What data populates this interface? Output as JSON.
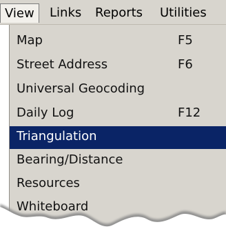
{
  "menubar": {
    "items": [
      {
        "label": "View"
      },
      {
        "label": "Links"
      },
      {
        "label": "Reports"
      },
      {
        "label": "Utilities"
      }
    ]
  },
  "dropdown": {
    "items": [
      {
        "label": "Map",
        "shortcut": "F5"
      },
      {
        "label": "Street Address",
        "shortcut": "F6"
      },
      {
        "label": "Universal Geocoding",
        "shortcut": ""
      },
      {
        "label": "Daily Log",
        "shortcut": "F12"
      },
      {
        "label": "Triangulation",
        "shortcut": ""
      },
      {
        "label": "Bearing/Distance",
        "shortcut": ""
      },
      {
        "label": "Resources",
        "shortcut": ""
      },
      {
        "label": "Whiteboard",
        "shortcut": ""
      }
    ]
  },
  "colors": {
    "menu_bg": "#d8d5ce",
    "highlight": "#0a2466",
    "highlight_text": "#ffffff"
  }
}
